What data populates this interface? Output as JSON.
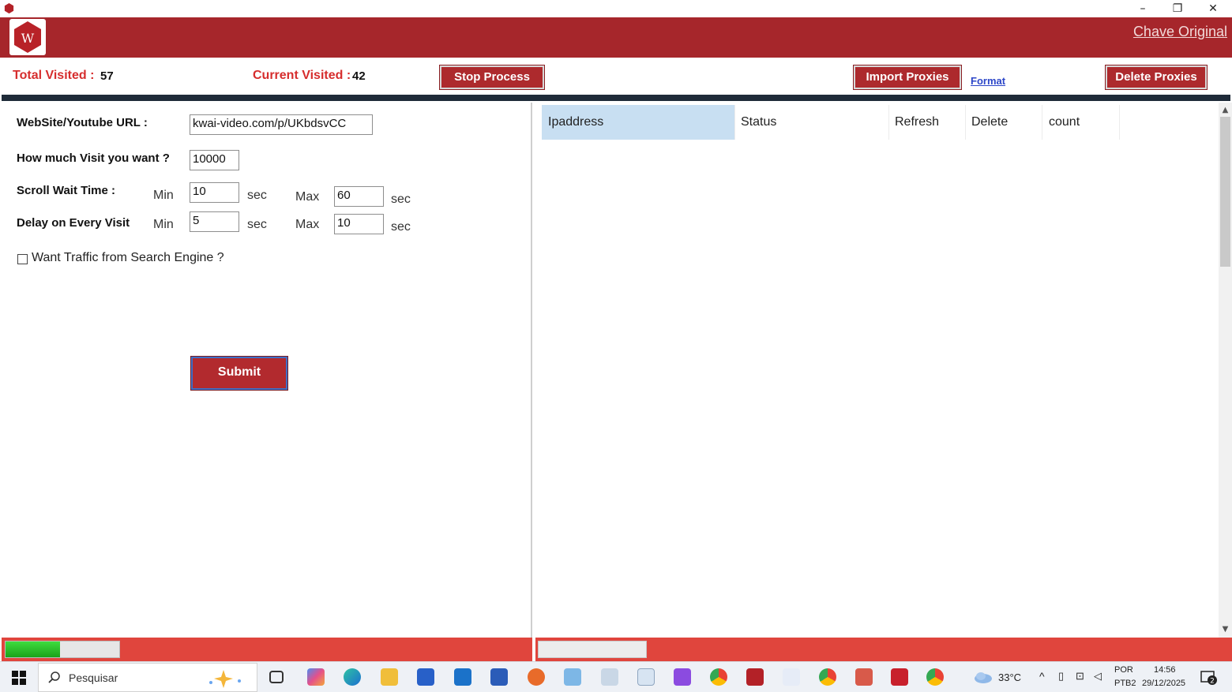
{
  "window": {
    "minimize": "–",
    "maximize": "❐",
    "close": "✕"
  },
  "header": {
    "logo_letter": "W",
    "link": "Chave Original",
    "brand_color": "#a6262b"
  },
  "stats": {
    "total_visited_label": "Total Visited :",
    "total_visited_value": "57",
    "current_visited_label": "Current Visited :",
    "current_visited_value": "42",
    "stop_button": "Stop Process",
    "import_button": "Import Proxies",
    "format_link": "Format",
    "delete_button": "Delete Proxies"
  },
  "form": {
    "url_label": "WebSite/Youtube URL :",
    "url_value": "kwai-video.com/p/UKbdsvCC",
    "visits_label": "How much Visit you want ?",
    "visits_value": "10000",
    "scroll_label": "Scroll Wait Time :",
    "scroll_min_label": "Min",
    "scroll_min_value": "10",
    "scroll_min_unit": "sec",
    "scroll_max_label": "Max",
    "scroll_max_value": "60",
    "scroll_max_unit": "sec",
    "delay_label": "Delay on Every Visit",
    "delay_min_label": "Min",
    "delay_min_value": "5",
    "delay_min_unit": "sec",
    "delay_max_label": "Max",
    "delay_max_value": "10",
    "delay_max_unit": "sec",
    "search_engine_label": "Want Traffic from Search Engine ?",
    "search_engine_checked": false,
    "submit_button": "Submit"
  },
  "grid": {
    "columns": [
      "Ipaddress",
      "Status",
      "Refresh",
      "Delete",
      "count"
    ],
    "rows": []
  },
  "status": {
    "progress_fraction": 0.48
  },
  "taskbar": {
    "search_placeholder": "Pesquisar",
    "weather": "33°C",
    "lang_top": "POR",
    "lang_bottom": "PTB2",
    "time": "14:56",
    "date": "29/12/2025",
    "notifications": "2"
  }
}
